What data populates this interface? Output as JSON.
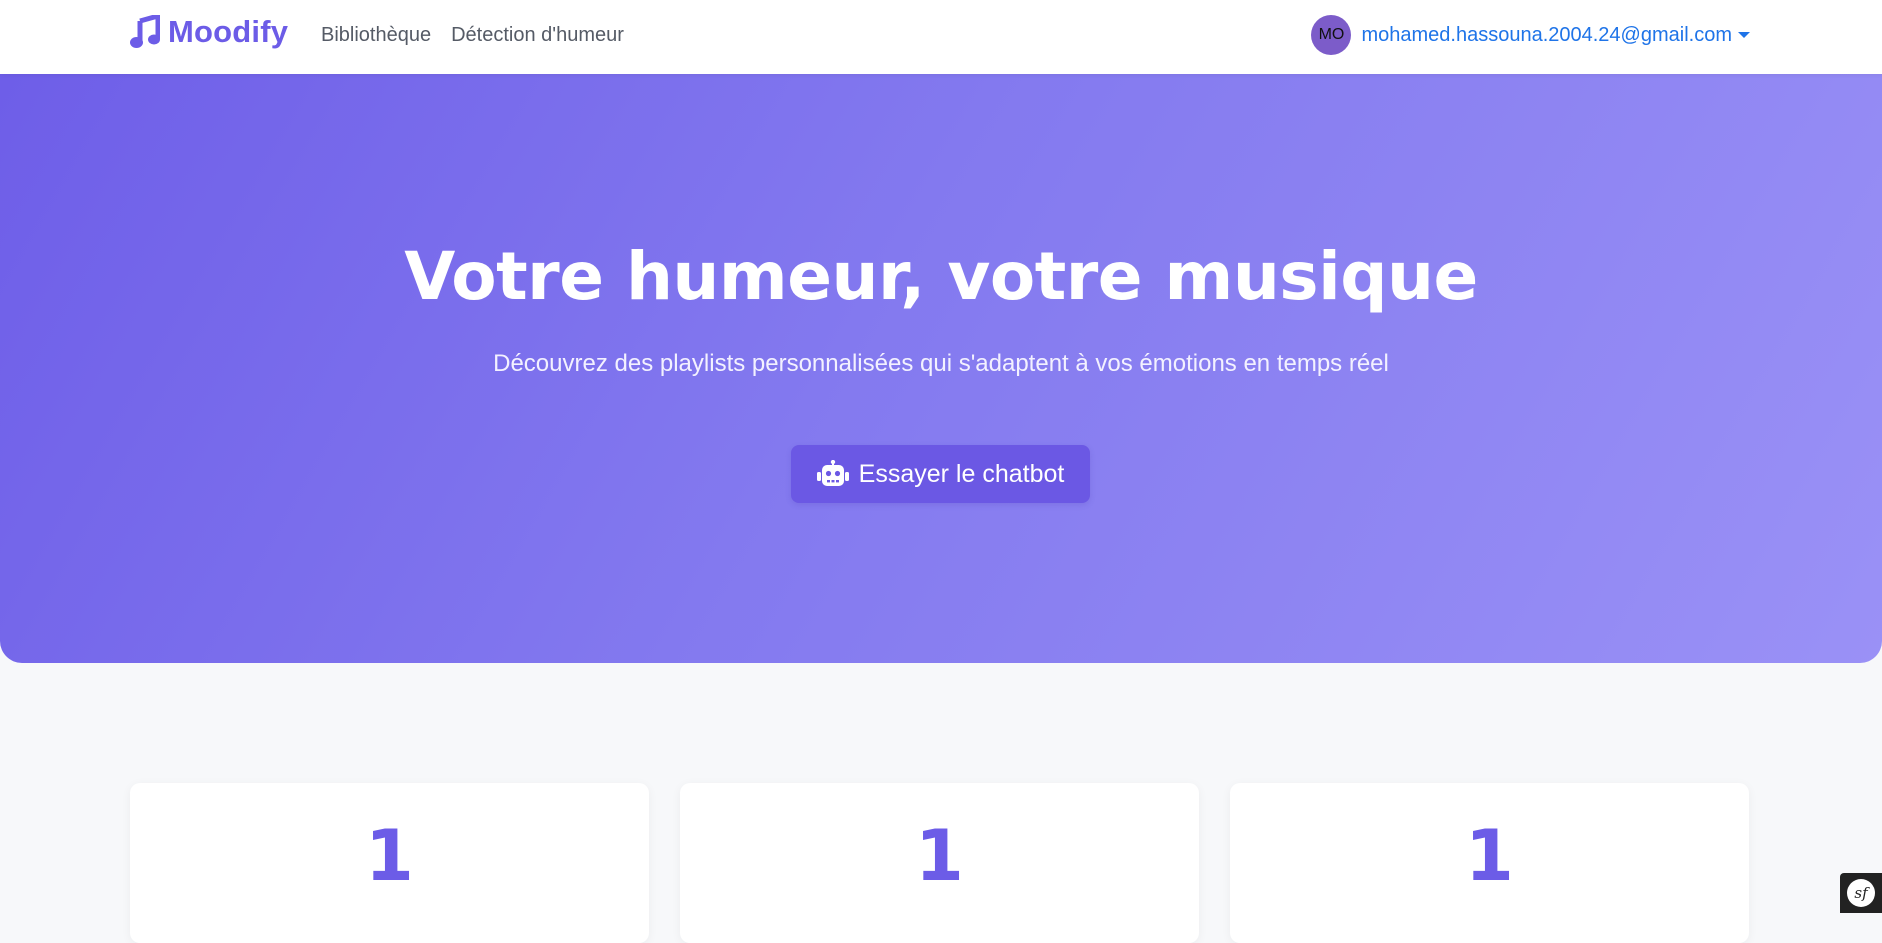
{
  "navbar": {
    "brand": "Moodify",
    "links": [
      "Bibliothèque",
      "Détection d'humeur"
    ],
    "user": {
      "avatar_initials": "MO",
      "email": "mohamed.hassouna.2004.24@gmail.com"
    }
  },
  "hero": {
    "title": "Votre humeur, votre musique",
    "subtitle": "Découvrez des playlists personnalisées qui s'adaptent à vos émotions en temps réel",
    "cta_label": "Essayer le chatbot",
    "cta_icon": "robot-icon"
  },
  "stats": [
    {
      "value": "1"
    },
    {
      "value": "1"
    },
    {
      "value": "1"
    }
  ],
  "debug_toolbar": {
    "logo": "sf"
  },
  "colors": {
    "brand": "#6c5ce7",
    "hero_gradient_start": "#6e5ee8",
    "hero_gradient_end": "#9a91f6",
    "button": "#6b58e4",
    "link_blue": "#1f74e8",
    "avatar": "#7c5cc9",
    "page_background": "#f7f8fa"
  }
}
